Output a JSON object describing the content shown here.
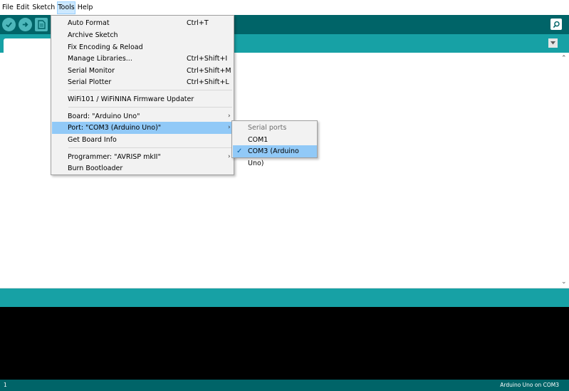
{
  "menubar": {
    "items": [
      "File",
      "Edit",
      "Sketch",
      "Tools",
      "Help"
    ]
  },
  "colors": {
    "toolbar": "#006468",
    "tabbar": "#17a1a5",
    "button": "#4db7bb",
    "highlight": "#91c9f7",
    "console": "#000000"
  },
  "toolbar": {
    "icons": [
      "verify-icon",
      "upload-icon",
      "new-sketch-icon",
      "serial-monitor-icon"
    ]
  },
  "tools_menu": {
    "items": [
      {
        "label": "Auto Format",
        "shortcut": "Ctrl+T"
      },
      {
        "label": "Archive Sketch",
        "shortcut": ""
      },
      {
        "label": "Fix Encoding & Reload",
        "shortcut": ""
      },
      {
        "label": "Manage Libraries...",
        "shortcut": "Ctrl+Shift+I"
      },
      {
        "label": "Serial Monitor",
        "shortcut": "Ctrl+Shift+M"
      },
      {
        "label": "Serial Plotter",
        "shortcut": "Ctrl+Shift+L"
      },
      {
        "label": "WiFi101 / WiFiNINA Firmware Updater",
        "shortcut": ""
      },
      {
        "label": "Board: \"Arduino Uno\"",
        "shortcut": ""
      },
      {
        "label": "Port: \"COM3 (Arduino Uno)\"",
        "shortcut": ""
      },
      {
        "label": "Get Board Info",
        "shortcut": ""
      },
      {
        "label": "Programmer: \"AVRISP mkII\"",
        "shortcut": ""
      },
      {
        "label": "Burn Bootloader",
        "shortcut": ""
      }
    ]
  },
  "port_submenu": {
    "header": "Serial ports",
    "items": [
      "COM1",
      "COM3 (Arduino Uno)"
    ],
    "selected": "COM3 (Arduino Uno)"
  },
  "statusbar": {
    "line": "1",
    "board": "Arduino Uno on COM3"
  }
}
